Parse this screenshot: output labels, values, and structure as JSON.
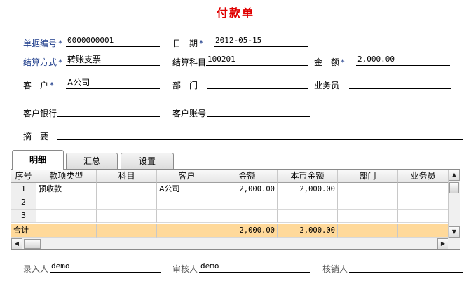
{
  "title": "付款单",
  "header": {
    "doc_no_label": "单据编号",
    "doc_no": "0000000001",
    "date_label": "日　期",
    "date": "2012-05-15",
    "settle_method_label": "结算方式",
    "settle_method": "转账支票",
    "settle_subject_label": "结算科目",
    "settle_subject": "100201",
    "amount_label": "金　额",
    "amount": "2,000.00",
    "customer_label": "客　户",
    "customer": "A公司",
    "dept_label": "部　门",
    "dept": "",
    "salesman_label": "业务员",
    "salesman": "",
    "bank_label": "客户银行",
    "bank": "",
    "account_label": "客户账号",
    "account": "",
    "memo_label": "摘　要",
    "memo": "",
    "required_mark": "*"
  },
  "tabs": [
    {
      "label": "明细"
    },
    {
      "label": "汇总"
    },
    {
      "label": "设置"
    }
  ],
  "grid": {
    "columns": [
      "序号",
      "款项类型",
      "科目",
      "客户",
      "金额",
      "本币金额",
      "部门",
      "业务员"
    ],
    "rows": [
      {
        "idx": "1",
        "type": "预收款",
        "subject": "",
        "customer": "A公司",
        "amount": "2,000.00",
        "local_amount": "2,000.00",
        "dept": "",
        "salesman": ""
      },
      {
        "idx": "2",
        "type": "",
        "subject": "",
        "customer": "",
        "amount": "",
        "local_amount": "",
        "dept": "",
        "salesman": ""
      },
      {
        "idx": "3",
        "type": "",
        "subject": "",
        "customer": "",
        "amount": "",
        "local_amount": "",
        "dept": "",
        "salesman": ""
      }
    ],
    "total": {
      "label": "合计",
      "amount": "2,000.00",
      "local_amount": "2,000.00"
    }
  },
  "footer": {
    "entered_by_label": "录入人",
    "entered_by": "demo",
    "reviewer_label": "审核人",
    "reviewer": "demo",
    "writeoff_label": "核销人",
    "writeoff": ""
  }
}
